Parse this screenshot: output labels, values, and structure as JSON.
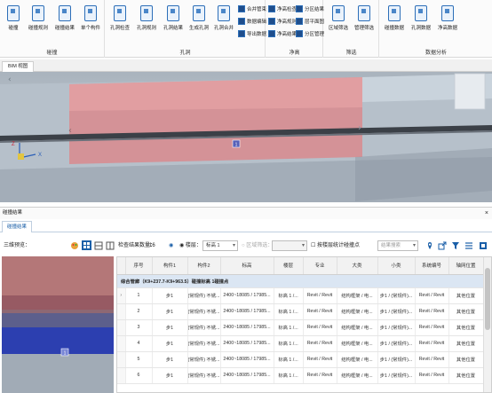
{
  "ribbon": {
    "groups": [
      {
        "label": "碰撞",
        "buttons": [
          "碰撞",
          "碰撞规则",
          "碰撞结果",
          "单个构件"
        ]
      },
      {
        "label": "孔洞",
        "buttons": [
          "孔洞检查",
          "孔洞规则",
          "孔洞结果",
          "生成孔洞",
          "孔洞合并"
        ],
        "side": [
          "合并管束",
          "数据编辑",
          "导出数据"
        ]
      },
      {
        "label": "净高",
        "side": [
          "净高检查",
          "净高规则",
          "净高结果",
          "分区结果",
          "层平面图",
          "分区管理"
        ]
      },
      {
        "label": "筛选",
        "buttons": [
          "区域筛选",
          "管理筛选"
        ]
      },
      {
        "label": "数据分析",
        "buttons": [
          "碰撞数据",
          "孔洞数据",
          "净高数据"
        ]
      }
    ]
  },
  "view_tab": "BIM 视图",
  "panel": {
    "title": "碰撞结果",
    "subtab": "碰撞结果"
  },
  "toolbar": {
    "three_d_label": "三维预览：",
    "count_label": "检查结果数量：",
    "count_value": "16",
    "radio_layer": "楼层：",
    "layer_value": "标高 1",
    "radio_region": "区域筛选：",
    "region_value": "",
    "checkbox_label": "按楼层统计碰撞点",
    "search_placeholder": "结果搜索"
  },
  "table": {
    "columns": [
      "序号",
      "构件1",
      "构件2",
      "标高",
      "楼层",
      "专业",
      "大类",
      "小类",
      "系统编号",
      "轴网位置"
    ],
    "group_label": "综合管廊（K9+237.7-K9+963.5）碰撞标高 1碰撞点",
    "rows": [
      [
        "1",
        "步1",
        "(常规件) 不锈...",
        "2400~18085 / 17985...",
        "标高 1 /...",
        "Revit / Revit",
        "结构框架 / 电...",
        "步1 / (常规件)...",
        "Revit / Revit",
        "其他位置"
      ],
      [
        "2",
        "步1",
        "(常规件) 不锈...",
        "2400~18085 / 17985...",
        "标高 1 /...",
        "Revit / Revit",
        "结构框架 / 电...",
        "步1 / (常规件)...",
        "Revit / Revit",
        "其他位置"
      ],
      [
        "3",
        "步1",
        "(常规件) 不锈...",
        "2400~18085 / 17985...",
        "标高 1 /...",
        "Revit / Revit",
        "结构框架 / 电...",
        "步1 / (常规件)...",
        "Revit / Revit",
        "其他位置"
      ],
      [
        "4",
        "步1",
        "(常规件) 不锈...",
        "2400~18085 / 17985...",
        "标高 1 /...",
        "Revit / Revit",
        "结构框架 / 电...",
        "步1 / (常规件)...",
        "Revit / Revit",
        "其他位置"
      ],
      [
        "5",
        "步1",
        "(常规件) 不锈...",
        "2400~18085 / 17985...",
        "标高 1 /...",
        "Revit / Revit",
        "结构框架 / 电...",
        "步1 / (常规件)...",
        "Revit / Revit",
        "其他位置"
      ],
      [
        "6",
        "步1",
        "(常规件) 不锈...",
        "2400~18085 / 17985...",
        "标高 1 /...",
        "Revit / Revit",
        "结构框架 / 电...",
        "步1 / (常规件)...",
        "Revit / Revit",
        "其他位置"
      ]
    ]
  },
  "axis_labels": {
    "x": "X",
    "z": "Z"
  },
  "marker_label": "1",
  "colors": {
    "accent": "#1a5fa8",
    "pipe_red": "#d96a6a",
    "highlight_blue": "#2c3fb0"
  }
}
